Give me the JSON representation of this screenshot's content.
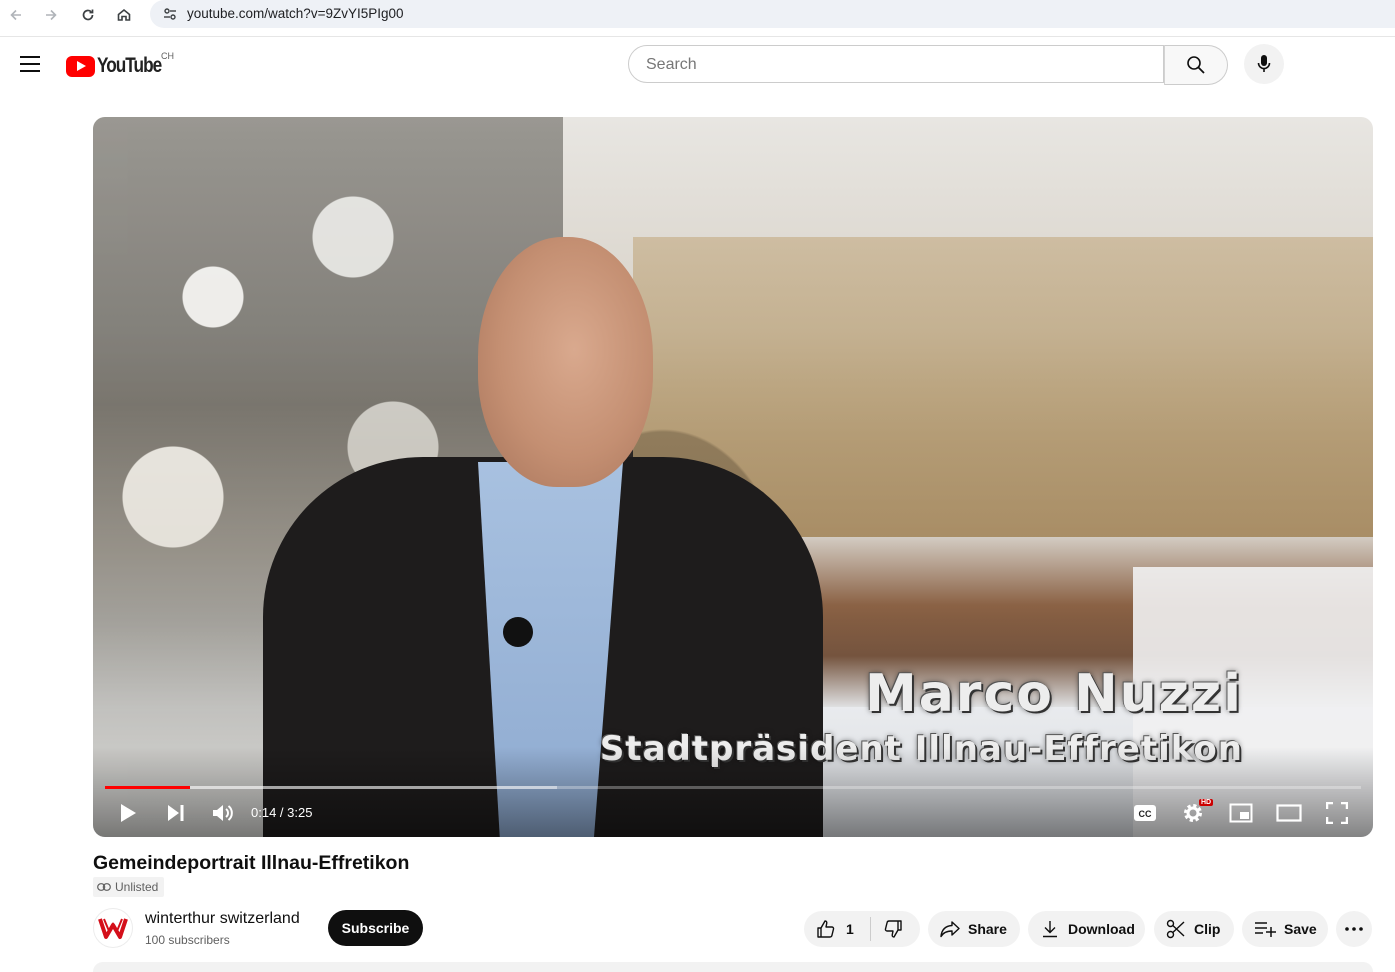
{
  "browser": {
    "url": "youtube.com/watch?v=9ZvYI5PIg00"
  },
  "header": {
    "logo_text": "YouTube",
    "country_code": "CH",
    "search_placeholder": "Search"
  },
  "video": {
    "overlay_name": "Marco Nuzzi",
    "overlay_title": "Stadtpräsident Illnau-Effretikon",
    "current_time": "0:14",
    "duration": "3:25",
    "time_display": "0:14 / 3:25",
    "played_fraction": 0.068,
    "buffered_fraction": 0.36,
    "quality_badge": "HD",
    "progress_color": "#ff0000"
  },
  "info": {
    "title": "Gemeindeportrait Illnau-Effretikon",
    "visibility": "Unlisted"
  },
  "channel": {
    "name": "winterthur switzerland",
    "subscribers": "100 subscribers",
    "subscribe_label": "Subscribe"
  },
  "actions": {
    "like_count": "1",
    "share_label": "Share",
    "download_label": "Download",
    "clip_label": "Clip",
    "save_label": "Save"
  }
}
